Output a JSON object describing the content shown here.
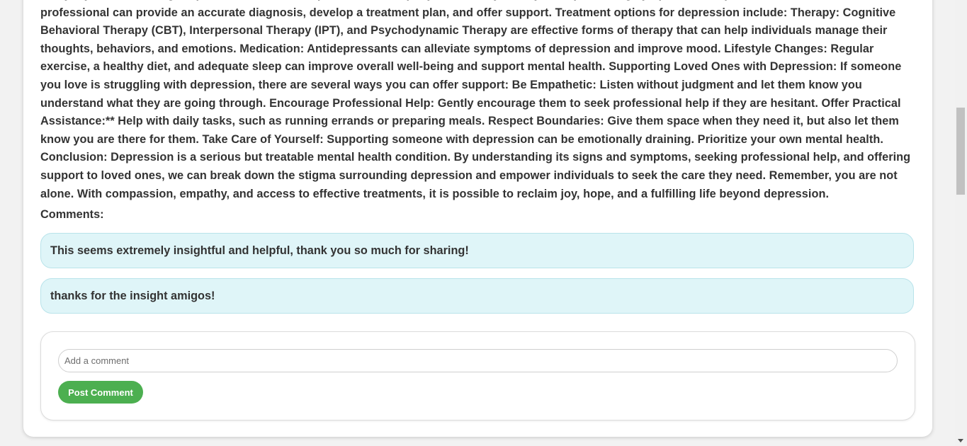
{
  "article": {
    "body": "everyday tasks. Seeking Help: It is crucial to seek professional help if you believe you may be experiencing symptoms of depression. A mental health professional can provide an accurate diagnosis, develop a treatment plan, and offer support. Treatment options for depression include: Therapy: Cognitive Behavioral Therapy (CBT), Interpersonal Therapy (IPT), and Psychodynamic Therapy are effective forms of therapy that can help individuals manage their thoughts, behaviors, and emotions. Medication: Antidepressants can alleviate symptoms of depression and improve mood. Lifestyle Changes: Regular exercise, a healthy diet, and adequate sleep can improve overall well-being and support mental health. Supporting Loved Ones with Depression: If someone you love is struggling with depression, there are several ways you can offer support: Be Empathetic: Listen without judgment and let them know you understand what they are going through. Encourage Professional Help: Gently encourage them to seek professional help if they are hesitant. Offer Practical Assistance:** Help with daily tasks, such as running errands or preparing meals. Respect Boundaries: Give them space when they need it, but also let them know you are there for them. Take Care of Yourself: Supporting someone with depression can be emotionally draining. Prioritize your own mental health. Conclusion: Depression is a serious but treatable mental health condition. By understanding its signs and symptoms, seeking professional help, and offering support to loved ones, we can break down the stigma surrounding depression and empower individuals to seek the care they need. Remember, you are not alone. With compassion, empathy, and access to effective treatments, it is possible to reclaim joy, hope, and a fulfilling life beyond depression."
  },
  "comments": {
    "heading": "Comments:",
    "items": [
      {
        "text": "This seems extremely insightful and helpful, thank you so much for sharing!"
      },
      {
        "text": "thanks for the insight amigos!"
      }
    ]
  },
  "comment_form": {
    "input_value": "",
    "input_placeholder": "Add a comment",
    "submit_label": "Post Comment",
    "submit_color": "#4caf50"
  },
  "colors": {
    "comment_background": "#dff5f8",
    "comment_border": "#b9e3ea",
    "text": "#333333"
  }
}
